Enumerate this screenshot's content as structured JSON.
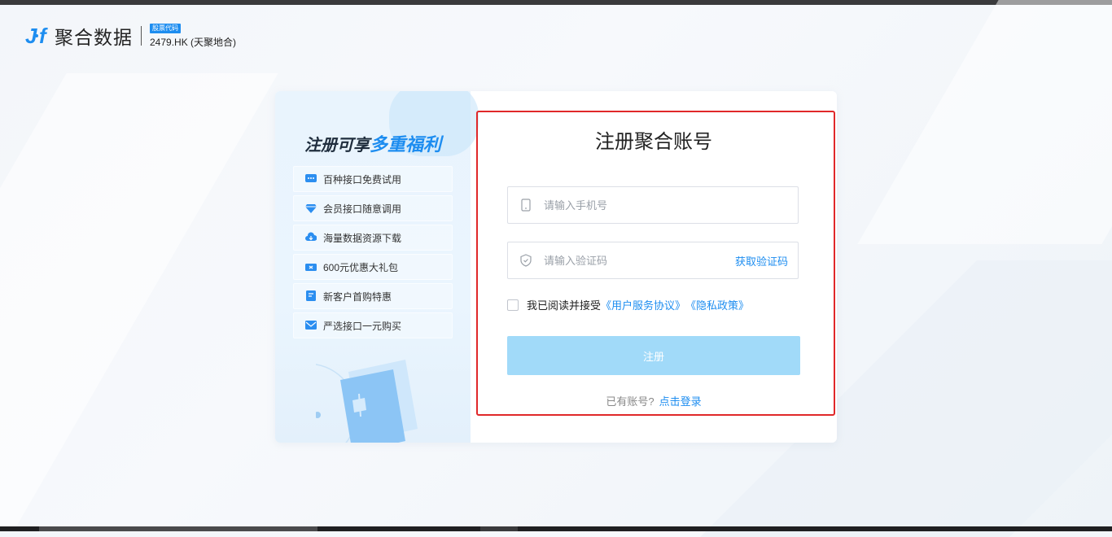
{
  "brand": {
    "logo_text": "聚合数据",
    "stock_badge": "股票代码",
    "stock_code": "2479.HK (天聚地合)"
  },
  "promo": {
    "title_prefix": "注册可享",
    "title_highlight": "多重福利",
    "benefits": [
      {
        "label": "百种接口免费试用",
        "icon": "chat-icon"
      },
      {
        "label": "会员接口随意调用",
        "icon": "diamond-icon"
      },
      {
        "label": "海量数据资源下载",
        "icon": "cloud-download-icon"
      },
      {
        "label": "600元优惠大礼包",
        "icon": "coupon-icon"
      },
      {
        "label": "新客户首购特惠",
        "icon": "document-icon"
      },
      {
        "label": "严选接口一元购买",
        "icon": "mail-icon"
      }
    ]
  },
  "form": {
    "title": "注册聚合账号",
    "phone_placeholder": "请输入手机号",
    "code_placeholder": "请输入验证码",
    "get_code_label": "获取验证码",
    "agree_text": "我已阅读并接受",
    "terms_link": "《用户服务协议》",
    "privacy_link": "《隐私政策》",
    "submit_label": "注册",
    "has_account_text": "已有账号?",
    "login_link": "点击登录"
  },
  "colors": {
    "accent": "#1d8df0",
    "submit_disabled": "#a1daf9",
    "highlight": "#e0282a"
  }
}
